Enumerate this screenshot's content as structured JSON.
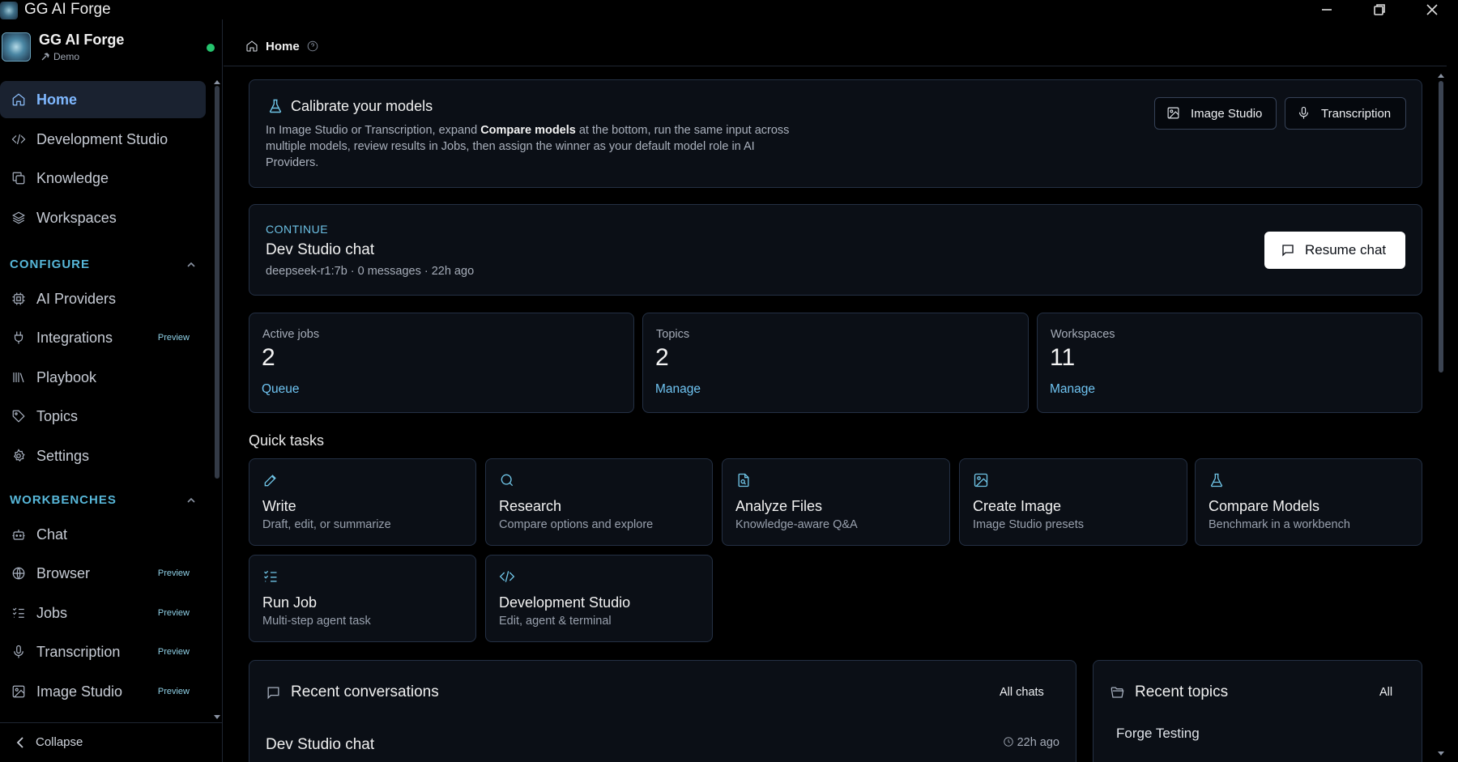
{
  "window": {
    "title": "GG AI Forge",
    "controls": {
      "minimize": "minimize-icon",
      "maximize": "restore-icon",
      "close": "close-icon"
    }
  },
  "sidebar": {
    "brand": {
      "name": "GG AI Forge",
      "workspace": "Demo",
      "status_color": "#25c46e"
    },
    "main_items": [
      {
        "label": "Home",
        "icon": "home-icon",
        "active": true
      },
      {
        "label": "Development Studio",
        "icon": "code-icon"
      },
      {
        "label": "Knowledge",
        "icon": "copy-icon"
      },
      {
        "label": "Workspaces",
        "icon": "layers-icon"
      }
    ],
    "configure": {
      "title": "CONFIGURE",
      "items": [
        {
          "label": "AI Providers",
          "icon": "cpu-icon",
          "badge": ""
        },
        {
          "label": "Integrations",
          "icon": "plug-icon",
          "badge": "Preview"
        },
        {
          "label": "Playbook",
          "icon": "library-icon",
          "badge": ""
        },
        {
          "label": "Topics",
          "icon": "tag-icon",
          "badge": ""
        },
        {
          "label": "Settings",
          "icon": "gear-icon",
          "badge": ""
        }
      ]
    },
    "workbenches": {
      "title": "WORKBENCHES",
      "items": [
        {
          "label": "Chat",
          "icon": "bot-icon",
          "badge": ""
        },
        {
          "label": "Browser",
          "icon": "globe-icon",
          "badge": "Preview"
        },
        {
          "label": "Jobs",
          "icon": "list-checks-icon",
          "badge": "Preview"
        },
        {
          "label": "Transcription",
          "icon": "mic-icon",
          "badge": "Preview"
        },
        {
          "label": "Image Studio",
          "icon": "image-icon",
          "badge": "Preview"
        }
      ]
    },
    "collapse_label": "Collapse"
  },
  "breadcrumb": {
    "current": "Home"
  },
  "calibrate": {
    "title": "Calibrate your models",
    "desc_1": "In Image Studio or Transcription, expand ",
    "desc_bold": "Compare models",
    "desc_2": " at the bottom, run the same input across multiple models, review results in Jobs, then assign the winner as your default model role in AI Providers.",
    "buttons": [
      {
        "label": "Image Studio",
        "icon": "image-icon"
      },
      {
        "label": "Transcription",
        "icon": "mic-icon"
      }
    ]
  },
  "continue": {
    "tag": "CONTINUE",
    "title": "Dev Studio chat",
    "meta": "deepseek-r1:7b · 0 messages · 22h ago",
    "button": "Resume chat"
  },
  "stats": [
    {
      "label": "Active jobs",
      "value": "2",
      "link": "Queue"
    },
    {
      "label": "Topics",
      "value": "2",
      "link": "Manage"
    },
    {
      "label": "Workspaces",
      "value": "11",
      "link": "Manage"
    }
  ],
  "quick_tasks": {
    "title": "Quick tasks",
    "items": [
      {
        "name": "Write",
        "sub": "Draft, edit, or summarize",
        "icon": "pen-icon"
      },
      {
        "name": "Research",
        "sub": "Compare options and explore",
        "icon": "search-icon"
      },
      {
        "name": "Analyze Files",
        "sub": "Knowledge-aware Q&A",
        "icon": "file-search-icon"
      },
      {
        "name": "Create Image",
        "sub": "Image Studio presets",
        "icon": "image-icon"
      },
      {
        "name": "Compare Models",
        "sub": "Benchmark in a workbench",
        "icon": "flask-icon"
      },
      {
        "name": "Run Job",
        "sub": "Multi-step agent task",
        "icon": "list-checks-icon"
      },
      {
        "name": "Development Studio",
        "sub": "Edit, agent & terminal",
        "icon": "code-icon"
      }
    ]
  },
  "recent_conversations": {
    "title": "Recent conversations",
    "all_label": "All chats",
    "items": [
      {
        "title": "Dev Studio chat",
        "time": "22h ago"
      }
    ]
  },
  "recent_topics": {
    "title": "Recent topics",
    "all_label": "All",
    "items": [
      {
        "title": "Forge Testing"
      }
    ]
  }
}
